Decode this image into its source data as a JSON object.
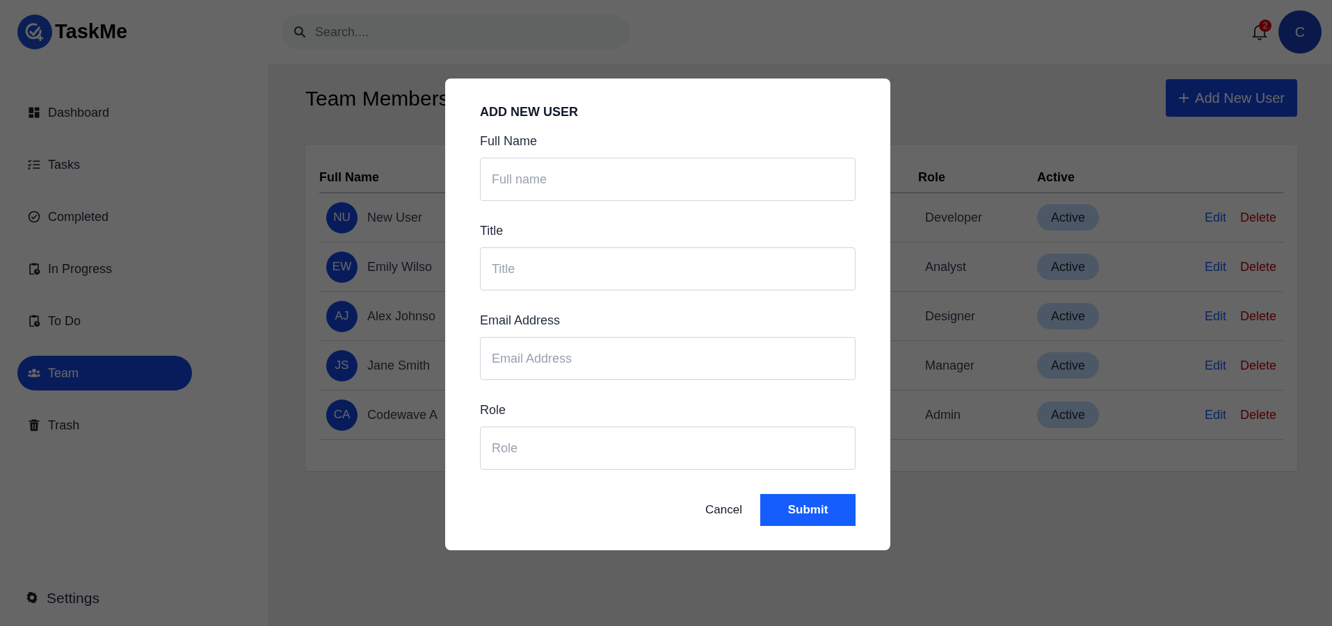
{
  "app": {
    "logo_text": "TaskMe"
  },
  "search": {
    "placeholder": "Search...."
  },
  "notifications": {
    "count": "2"
  },
  "user_avatar": {
    "initial": "C"
  },
  "sidebar": {
    "items": [
      {
        "label": "Dashboard",
        "kind": "dashboard",
        "selected": false
      },
      {
        "label": "Tasks",
        "kind": "tasks",
        "selected": false
      },
      {
        "label": "Completed",
        "kind": "completed",
        "selected": false
      },
      {
        "label": "In Progress",
        "kind": "clipboard",
        "selected": false
      },
      {
        "label": "To Do",
        "kind": "clipboard",
        "selected": false
      },
      {
        "label": "Team",
        "kind": "team",
        "selected": true
      },
      {
        "label": "Trash",
        "kind": "trash",
        "selected": false
      }
    ],
    "settings": {
      "label": "Settings"
    }
  },
  "page": {
    "title": "Team Members",
    "add_button": "Add New User"
  },
  "table": {
    "columns": [
      "Full Name",
      "Role",
      "Active"
    ],
    "rows": [
      {
        "initials": "NU",
        "name": "New User",
        "role": "Developer",
        "status": "Active",
        "actions": [
          "Edit",
          "Delete"
        ]
      },
      {
        "initials": "EW",
        "name": "Emily Wilso",
        "role": "Analyst",
        "status": "Active",
        "actions": [
          "Edit",
          "Delete"
        ]
      },
      {
        "initials": "AJ",
        "name": "Alex Johnso",
        "role": "Designer",
        "status": "Active",
        "actions": [
          "Edit",
          "Delete"
        ]
      },
      {
        "initials": "JS",
        "name": "Jane Smith",
        "role": "Manager",
        "status": "Active",
        "actions": [
          "Edit",
          "Delete"
        ]
      },
      {
        "initials": "CA",
        "name": "Codewave A",
        "role": "Admin",
        "status": "Active",
        "actions": [
          "Edit",
          "Delete"
        ]
      }
    ]
  },
  "modal": {
    "title": "ADD NEW USER",
    "fields": [
      {
        "label": "Full Name",
        "placeholder": "Full name"
      },
      {
        "label": "Title",
        "placeholder": "Title"
      },
      {
        "label": "Email Address",
        "placeholder": "Email Address"
      },
      {
        "label": "Role",
        "placeholder": "Role"
      }
    ],
    "cancel": "Cancel",
    "submit": "Submit"
  }
}
